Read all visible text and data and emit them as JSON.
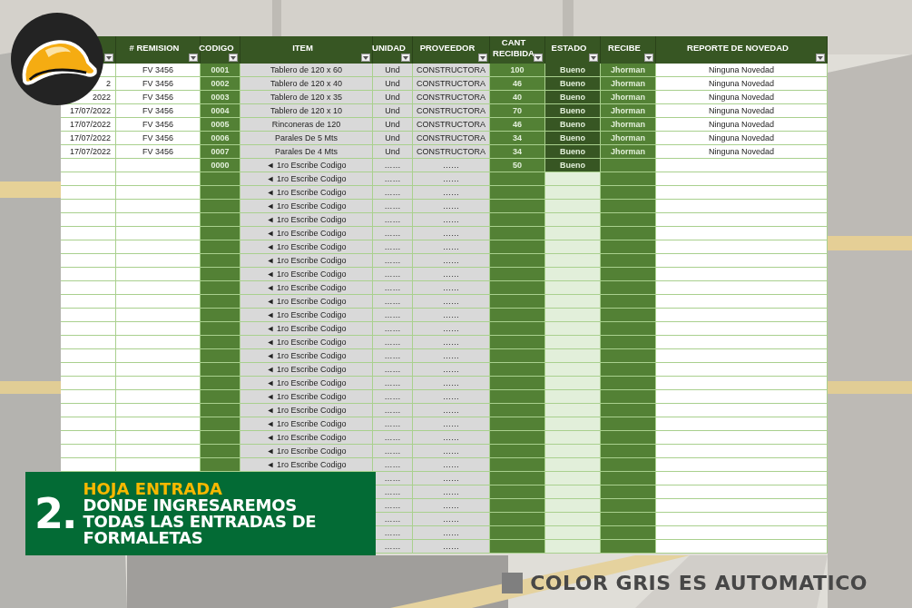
{
  "table": {
    "columns": [
      {},
      {
        "label": "# REMISION"
      },
      {
        "label": "CODIGO"
      },
      {
        "label": "ITEM"
      },
      {
        "label": "UNIDAD"
      },
      {
        "label": "PROVEEDOR"
      },
      {
        "label": "CANT RECIBIDA"
      },
      {
        "label": "ESTADO"
      },
      {
        "label": "RECIBE"
      },
      {
        "label": "REPORTE DE NOVEDAD"
      }
    ],
    "rows": [
      {
        "remision": "FV 3456",
        "codigo": "0001",
        "item": "Tablero de 120 x 60",
        "unidad": "Und",
        "proveedor": "CONSTRUCTORA",
        "cant": "100",
        "estado": "Bueno",
        "recibe": "Jhorman",
        "reporte": "Ninguna Novedad"
      },
      {
        "date": "2",
        "remision": "FV 3456",
        "codigo": "0002",
        "item": "Tablero de 120 x 40",
        "unidad": "Und",
        "proveedor": "CONSTRUCTORA",
        "cant": "46",
        "estado": "Bueno",
        "recibe": "Jhorman",
        "reporte": "Ninguna Novedad"
      },
      {
        "date": "2022",
        "remision": "FV 3456",
        "codigo": "0003",
        "item": "Tablero de 120 x 35",
        "unidad": "Und",
        "proveedor": "CONSTRUCTORA",
        "cant": "40",
        "estado": "Bueno",
        "recibe": "Jhorman",
        "reporte": "Ninguna Novedad"
      },
      {
        "date": "17/07/2022",
        "remision": "FV 3456",
        "codigo": "0004",
        "item": "Tablero de 120 x 10",
        "unidad": "Und",
        "proveedor": "CONSTRUCTORA",
        "cant": "70",
        "estado": "Bueno",
        "recibe": "Jhorman",
        "reporte": "Ninguna Novedad"
      },
      {
        "date": "17/07/2022",
        "remision": "FV 3456",
        "codigo": "0005",
        "item": "Rinconeras de 120",
        "unidad": "Und",
        "proveedor": "CONSTRUCTORA",
        "cant": "46",
        "estado": "Bueno",
        "recibe": "Jhorman",
        "reporte": "Ninguna Novedad"
      },
      {
        "date": "17/07/2022",
        "remision": "FV 3456",
        "codigo": "0006",
        "item": "Parales De 5 Mts",
        "unidad": "Und",
        "proveedor": "CONSTRUCTORA",
        "cant": "34",
        "estado": "Bueno",
        "recibe": "Jhorman",
        "reporte": "Ninguna Novedad"
      },
      {
        "date": "17/07/2022",
        "remision": "FV 3456",
        "codigo": "0007",
        "item": "Parales De 4 Mts",
        "unidad": "Und",
        "proveedor": "CONSTRUCTORA",
        "cant": "34",
        "estado": "Bueno",
        "recibe": "Jhorman",
        "reporte": "Ninguna Novedad"
      },
      {
        "codigo": "0000",
        "item": "◄ 1ro Escribe Codigo",
        "unidad": "……",
        "proveedor": "……",
        "cant": "50",
        "estado": "Bueno"
      },
      {
        "item": "◄ 1ro Escribe Codigo",
        "unidad": "……",
        "proveedor": "……"
      },
      {
        "item": "◄ 1ro Escribe Codigo",
        "unidad": "……",
        "proveedor": "……"
      },
      {
        "item": "◄ 1ro Escribe Codigo",
        "unidad": "……",
        "proveedor": "……"
      },
      {
        "item": "◄ 1ro Escribe Codigo",
        "unidad": "……",
        "proveedor": "……"
      },
      {
        "item": "◄ 1ro Escribe Codigo",
        "unidad": "……",
        "proveedor": "……"
      },
      {
        "item": "◄ 1ro Escribe Codigo",
        "unidad": "……",
        "proveedor": "……"
      },
      {
        "item": "◄ 1ro Escribe Codigo",
        "unidad": "……",
        "proveedor": "……"
      },
      {
        "item": "◄ 1ro Escribe Codigo",
        "unidad": "……",
        "proveedor": "……"
      },
      {
        "item": "◄ 1ro Escribe Codigo",
        "unidad": "……",
        "proveedor": "……"
      },
      {
        "item": "◄ 1ro Escribe Codigo",
        "unidad": "……",
        "proveedor": "……"
      },
      {
        "item": "◄ 1ro Escribe Codigo",
        "unidad": "……",
        "proveedor": "……"
      },
      {
        "item": "◄ 1ro Escribe Codigo",
        "unidad": "……",
        "proveedor": "……"
      },
      {
        "item": "◄ 1ro Escribe Codigo",
        "unidad": "……",
        "proveedor": "……"
      },
      {
        "item": "◄ 1ro Escribe Codigo",
        "unidad": "……",
        "proveedor": "……"
      },
      {
        "item": "◄ 1ro Escribe Codigo",
        "unidad": "……",
        "proveedor": "……"
      },
      {
        "item": "◄ 1ro Escribe Codigo",
        "unidad": "……",
        "proveedor": "……"
      },
      {
        "item": "◄ 1ro Escribe Codigo",
        "unidad": "……",
        "proveedor": "……"
      },
      {
        "item": "◄ 1ro Escribe Codigo",
        "unidad": "……",
        "proveedor": "……"
      },
      {
        "item": "◄ 1ro Escribe Codigo",
        "unidad": "……",
        "proveedor": "……"
      },
      {
        "item": "◄ 1ro Escribe Codigo",
        "unidad": "……",
        "proveedor": "……"
      },
      {
        "item": "◄ 1ro Escribe Codigo",
        "unidad": "……",
        "proveedor": "……"
      },
      {
        "item": "◄ 1ro Escribe Codigo",
        "unidad": "……",
        "proveedor": "……"
      },
      {
        "unidad": "……",
        "proveedor": "……"
      },
      {
        "unidad": "……",
        "proveedor": "……"
      },
      {
        "unidad": "……",
        "proveedor": "……"
      },
      {
        "unidad": "……",
        "proveedor": "……"
      },
      {
        "unidad": "……",
        "proveedor": "……"
      },
      {
        "unidad": "……",
        "proveedor": "……"
      }
    ]
  },
  "banner": {
    "number": "2.",
    "title": "HOJA ENTRADA",
    "lines": [
      "DONDE INGRESAREMOS",
      "TODAS LAS ENTRADAS DE",
      "FORMALETAS"
    ]
  },
  "legend": {
    "text": "COLOR GRIS ES AUTOMATICO"
  }
}
